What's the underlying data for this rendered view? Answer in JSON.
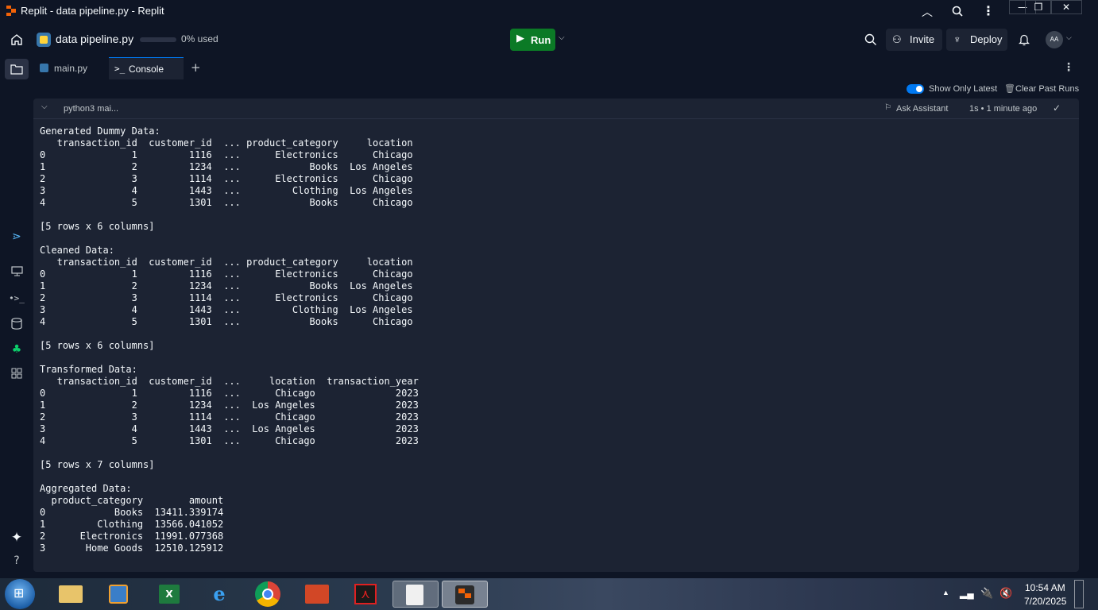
{
  "window": {
    "title": "Replit - data pipeline.py - Replit",
    "controls": [
      "—",
      "❐",
      "✕"
    ]
  },
  "topnav": {
    "project_name": "data pipeline.py",
    "usage": "0% used",
    "run_label": "Run",
    "invite_label": "Invite",
    "deploy_label": "Deploy",
    "avatar_initials": "AA"
  },
  "tabs": [
    {
      "label": "main.py",
      "active": false
    },
    {
      "label": "Console",
      "active": true
    }
  ],
  "console_toolbar": {
    "show_only_latest": "Show Only Latest",
    "clear_past_runs": "Clear Past Runs"
  },
  "run_header": {
    "command": "python3 mai...",
    "ask_assistant": "Ask Assistant",
    "timing": "1s • 1 minute ago"
  },
  "output": [
    "Generated Dummy Data:",
    "   transaction_id  customer_id  ... product_category     location",
    "0               1         1116  ...      Electronics      Chicago",
    "1               2         1234  ...            Books  Los Angeles",
    "2               3         1114  ...      Electronics      Chicago",
    "3               4         1443  ...         Clothing  Los Angeles",
    "4               5         1301  ...            Books      Chicago",
    "",
    "[5 rows x 6 columns]",
    "",
    "Cleaned Data:",
    "   transaction_id  customer_id  ... product_category     location",
    "0               1         1116  ...      Electronics      Chicago",
    "1               2         1234  ...            Books  Los Angeles",
    "2               3         1114  ...      Electronics      Chicago",
    "3               4         1443  ...         Clothing  Los Angeles",
    "4               5         1301  ...            Books      Chicago",
    "",
    "[5 rows x 6 columns]",
    "",
    "Transformed Data:",
    "   transaction_id  customer_id  ...     location  transaction_year",
    "0               1         1116  ...      Chicago              2023",
    "1               2         1234  ...  Los Angeles              2023",
    "2               3         1114  ...      Chicago              2023",
    "3               4         1443  ...  Los Angeles              2023",
    "4               5         1301  ...      Chicago              2023",
    "",
    "[5 rows x 7 columns]",
    "",
    "Aggregated Data:",
    "  product_category        amount",
    "0            Books  13411.339174",
    "1         Clothing  13566.041052",
    "2      Electronics  11991.077368",
    "3       Home Goods  12510.125912"
  ],
  "taskbar": {
    "time": "10:54 AM",
    "date": "7/20/2025"
  },
  "colors": {
    "background": "#0e1525",
    "panel": "#1c2333",
    "run_button": "#0b7a26",
    "toggle": "#0079f2"
  }
}
